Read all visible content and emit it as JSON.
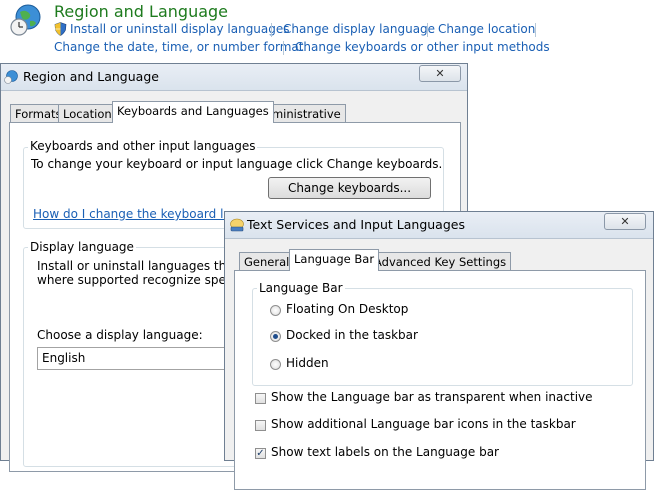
{
  "control_panel": {
    "title": "Region and Language",
    "links": {
      "install_uninstall": "Install or uninstall display languages",
      "change_display": "Change display language",
      "change_location": "Change location",
      "change_date": "Change the date, time, or number format",
      "change_keyboards": "Change keyboards or other input methods"
    }
  },
  "region_dialog": {
    "title": "Region and Language",
    "close_glyph": "✕",
    "tabs": [
      "Formats",
      "Location",
      "Keyboards and Languages",
      "Administrative"
    ],
    "keyboards_group": {
      "label": "Keyboards and other input languages",
      "description": "To change your keyboard or input language click Change keyboards.",
      "button": "Change keyboards...",
      "help_link": "How do I change the keyboard layou"
    },
    "display_group": {
      "label": "Display language",
      "line1": "Install or uninstall languages that W",
      "line2": "where supported recognize speech a",
      "choose_label": "Choose a display language:",
      "selected": "English"
    }
  },
  "text_services_dialog": {
    "title": "Text Services and Input Languages",
    "close_glyph": "✕",
    "tabs": [
      "General",
      "Language Bar",
      "Advanced Key Settings"
    ],
    "language_bar_group": {
      "label": "Language Bar",
      "options": [
        "Floating On Desktop",
        "Docked in the taskbar",
        "Hidden"
      ],
      "selected_index": 1
    },
    "checkboxes": [
      {
        "label": "Show the Language bar as transparent when inactive",
        "checked": false
      },
      {
        "label": "Show additional Language bar icons in the taskbar",
        "checked": false
      },
      {
        "label": "Show text labels on the Language bar",
        "checked": true
      }
    ],
    "check_glyph": "✓"
  },
  "colors": {
    "title_green": "#1e7b1e",
    "link_blue": "#1a5fb4",
    "dialog_bg": "#f0f0f0"
  },
  "icons": {
    "control_panel": "globe-clock-icon",
    "shield": "uac-shield-icon"
  }
}
